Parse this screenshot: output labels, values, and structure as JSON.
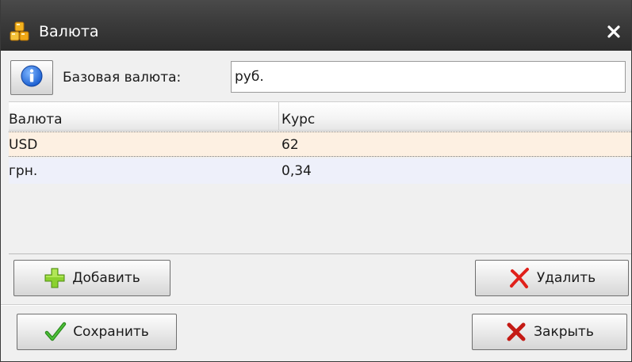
{
  "window": {
    "title": "Валюта",
    "app_icon": "coins-icon",
    "close_icon": "close-icon"
  },
  "base_currency": {
    "info_icon": "info-icon",
    "label": "Базовая валюта:",
    "value": "руб."
  },
  "grid": {
    "columns": [
      "Валюта",
      "Курс"
    ],
    "rows": [
      {
        "currency": "USD",
        "rate": "62"
      },
      {
        "currency": "грн.",
        "rate": "0,34"
      }
    ],
    "selected_row": 0
  },
  "buttons": {
    "add_label": "Добавить",
    "delete_label": "Удалить",
    "save_label": "Сохранить",
    "close_label": "Закрыть"
  },
  "colors": {
    "titlebar": "#3b3b3b",
    "selected_row": "#fdf0e2",
    "alt_row": "#eef0fa",
    "add_icon": "#8bd12e",
    "delete_icon": "#e0201a",
    "save_icon": "#2a8a1c",
    "close_icon": "#c41a14"
  }
}
